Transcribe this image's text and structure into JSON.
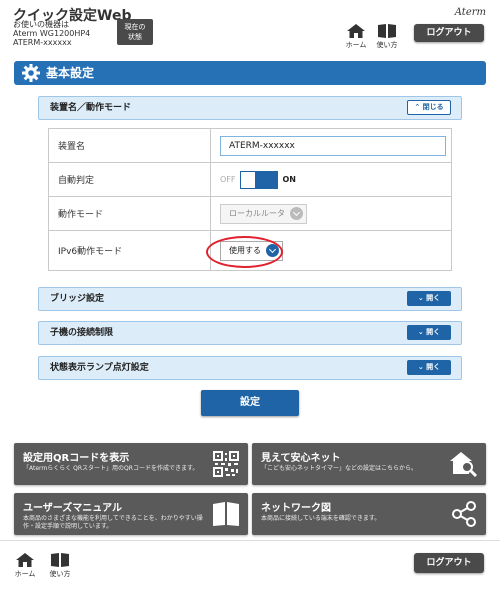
{
  "header": {
    "app_title": "クイック設定Web",
    "device_line1": "お使いの機器は",
    "device_line2": "Aterm WG1200HP4",
    "device_line3": "ATERM-xxxxxx",
    "status_label_1": "現在の",
    "status_label_2": "状態",
    "brand": "Aterm",
    "home_label": "ホーム",
    "help_label": "使い方",
    "logout_label": "ログアウト"
  },
  "section": {
    "title": "基本設定"
  },
  "panel_main": {
    "title": "装置名／動作モード",
    "close_label": "閉じる"
  },
  "rows": {
    "device_name_label": "装置名",
    "device_name_value": "ATERM-xxxxxx",
    "auto_detect_label": "自動判定",
    "auto_off": "OFF",
    "auto_on": "ON",
    "mode_label": "動作モード",
    "mode_value": "ローカルルータ",
    "ipv6_label": "IPv6動作モード",
    "ipv6_value": "使用する"
  },
  "accordions": {
    "bridge": "ブリッジ設定",
    "child_limit": "子機の接続制限",
    "lamp": "状態表示ランプ点灯設定",
    "open_label": "開く"
  },
  "actions": {
    "set_label": "設定"
  },
  "panels": {
    "qr_title": "設定用QRコードを表示",
    "qr_sub": "「Atermらくらく QRスタート」用のQRコードを作成できます。",
    "safe_title": "見えて安心ネット",
    "safe_sub": "「こども安心ネットタイマー」などの設定はこちらから。",
    "manual_title": "ユーザーズマニュアル",
    "manual_sub": "本商品のさまざまな機能を利用してできることを、わかりやすい操作・設定手順で説明しています。",
    "network_title": "ネットワーク図",
    "network_sub": "本商品に接続している端末を確認できます。"
  },
  "footer": {
    "home_label": "ホーム",
    "help_label": "使い方",
    "logout_label": "ログアウト"
  },
  "colors": {
    "accent": "#1e64a6",
    "title_bar": "#2670b5",
    "panel": "#5a5a5a",
    "highlight": "#e0212f"
  }
}
